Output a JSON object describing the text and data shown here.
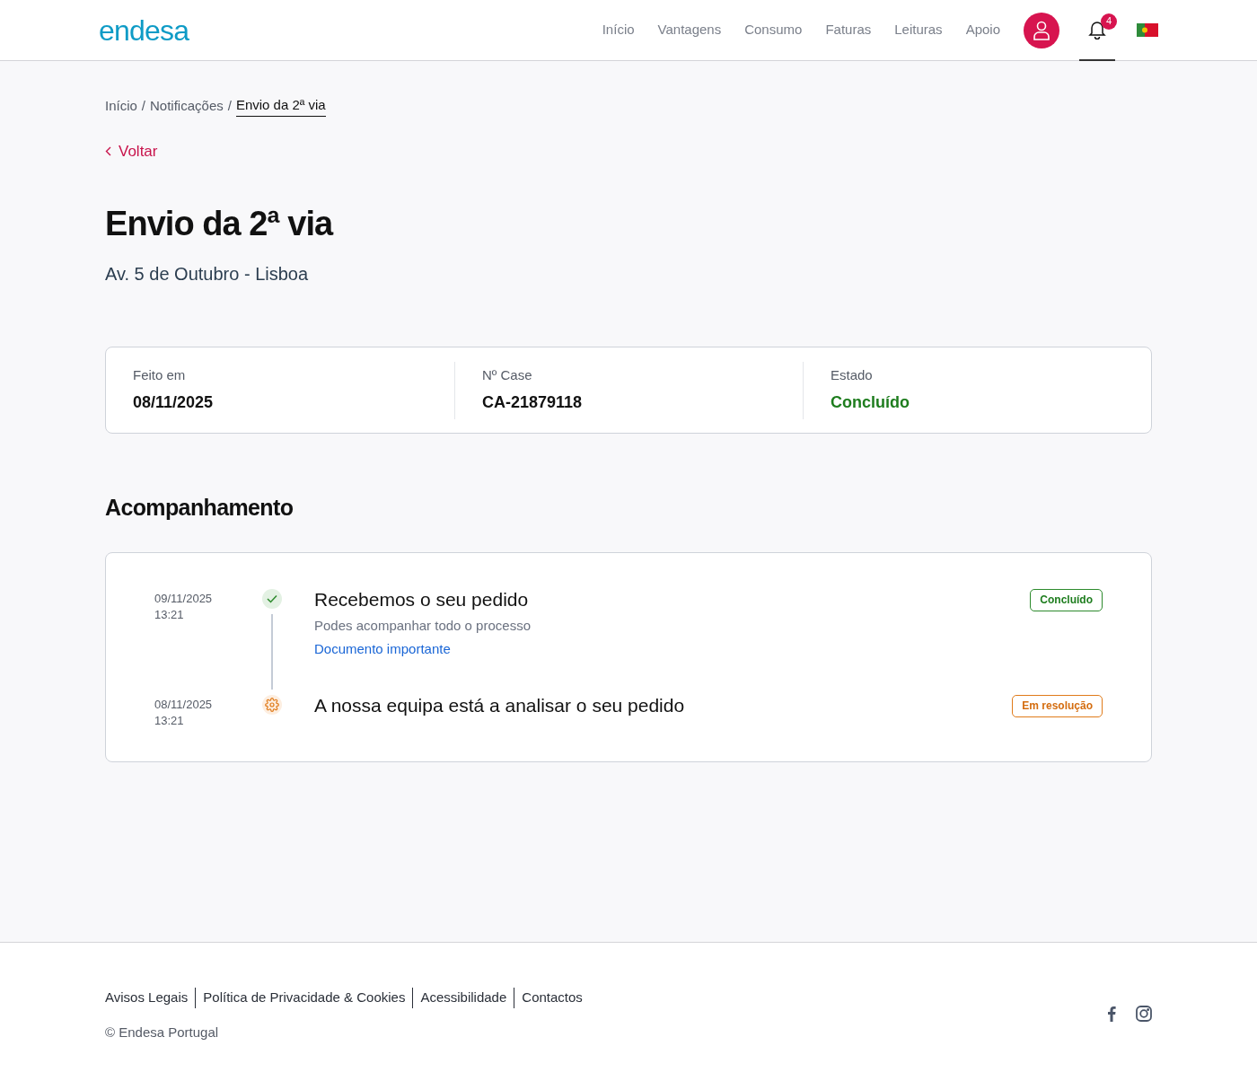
{
  "header": {
    "logo": "endesa",
    "nav": [
      {
        "label": "Início",
        "selected": false
      },
      {
        "label": "Vantagens",
        "selected": false
      },
      {
        "label": "Consumo",
        "selected": false
      },
      {
        "label": "Faturas",
        "selected": false
      },
      {
        "label": "Leituras",
        "selected": false
      },
      {
        "label": "Apoio",
        "selected": false
      }
    ],
    "notifications": {
      "count": "4",
      "selected": true
    }
  },
  "breadcrumb": [
    {
      "label": "Início",
      "current": false
    },
    {
      "separator": "/",
      "label": "Notificações",
      "current": false
    },
    {
      "separator": "/",
      "label": "Envio da 2ª via",
      "current": true
    }
  ],
  "back_link": "Voltar",
  "title": "Envio da 2ª via",
  "subtitle": "Av. 5 de Outubro - Lisboa",
  "summary": [
    {
      "label": "Feito em",
      "value": "08/11/2025",
      "kind": "plain"
    },
    {
      "label": "Nº Case",
      "value": "CA-21879118",
      "kind": "plain"
    },
    {
      "label": "Estado",
      "value": "Concluído",
      "kind": "status"
    }
  ],
  "tracking": {
    "heading": "Acompanhamento",
    "events": [
      {
        "date": "09/11/2025",
        "time": "13:21",
        "kind": "done",
        "title": "Recebemos o seu pedido",
        "description": "Podes acompanhar todo o processo",
        "link": "Documento importante",
        "badge": "Concluído"
      },
      {
        "date": "08/11/2025",
        "time": "13:21",
        "kind": "in_progress",
        "title": "A nossa equipa está a analisar o seu pedido",
        "badge": "Em resolução"
      }
    ]
  },
  "footer": {
    "links": [
      "Avisos Legais",
      "Política de Privacidade & Cookies",
      "Acessibilidade",
      "Contactos"
    ],
    "copyright": "© Endesa Portugal"
  }
}
